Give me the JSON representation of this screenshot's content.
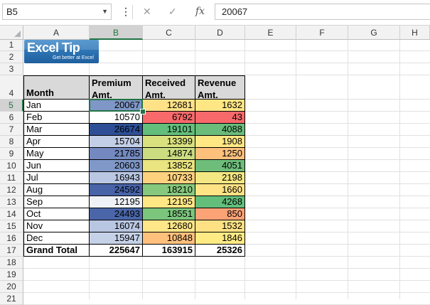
{
  "name_box": "B5",
  "formula": "20067",
  "columns": [
    "A",
    "B",
    "C",
    "D",
    "E",
    "F",
    "G",
    "H"
  ],
  "rows": [
    "1",
    "2",
    "3",
    "4",
    "5",
    "6",
    "7",
    "8",
    "9",
    "10",
    "11",
    "12",
    "13",
    "14",
    "15",
    "16",
    "17",
    "18",
    "19",
    "20",
    "21"
  ],
  "logo": {
    "main": "Excel",
    "tip": "Tip",
    "tagline": "Get better at Excel"
  },
  "table": {
    "headers": [
      "Month",
      "Premium Amt.",
      "Received Amt.",
      "Revenue Amt."
    ],
    "rows": [
      {
        "month": "Jan",
        "premium": "20067",
        "received": "12681",
        "revenue": "1632"
      },
      {
        "month": "Feb",
        "premium": "10570",
        "received": "6792",
        "revenue": "43"
      },
      {
        "month": "Mar",
        "premium": "26674",
        "received": "19101",
        "revenue": "4088"
      },
      {
        "month": "Apr",
        "premium": "15704",
        "received": "13399",
        "revenue": "1908"
      },
      {
        "month": "May",
        "premium": "21785",
        "received": "14874",
        "revenue": "1250"
      },
      {
        "month": "Jun",
        "premium": "20603",
        "received": "13852",
        "revenue": "4051"
      },
      {
        "month": "Jul",
        "premium": "16943",
        "received": "10733",
        "revenue": "2198"
      },
      {
        "month": "Aug",
        "premium": "24592",
        "received": "18210",
        "revenue": "1660"
      },
      {
        "month": "Sep",
        "premium": "12195",
        "received": "12195",
        "revenue": "4268"
      },
      {
        "month": "Oct",
        "premium": "24493",
        "received": "18551",
        "revenue": "850"
      },
      {
        "month": "Nov",
        "premium": "16074",
        "received": "12680",
        "revenue": "1532"
      },
      {
        "month": "Dec",
        "premium": "15947",
        "received": "10848",
        "revenue": "1846"
      }
    ],
    "total": {
      "label": "Grand Total",
      "premium": "225647",
      "received": "163915",
      "revenue": "25326"
    }
  },
  "colors": {
    "premium": [
      "#7f97c6",
      "#ffffff",
      "#2e4f96",
      "#c3cfe6",
      "#7389c0",
      "#8098c8",
      "#bac7e2",
      "#4863a8",
      "#eef1f8",
      "#4a66a9",
      "#b9c6e1",
      "#c5d1e7"
    ],
    "received": [
      "#ffe188",
      "#f8696b",
      "#63be7b",
      "#d9e17f",
      "#cbdc81",
      "#eae481",
      "#fed17f",
      "#86c87d",
      "#ffe785",
      "#7bc57c",
      "#ffe688",
      "#fec07c"
    ],
    "revenue": [
      "#ffe684",
      "#f8696b",
      "#6abc7a",
      "#ffe784",
      "#fdc17c",
      "#6ebd7a",
      "#f4e682",
      "#ffe384",
      "#63be7b",
      "#fba276",
      "#ffe184",
      "#ffeb84"
    ]
  }
}
